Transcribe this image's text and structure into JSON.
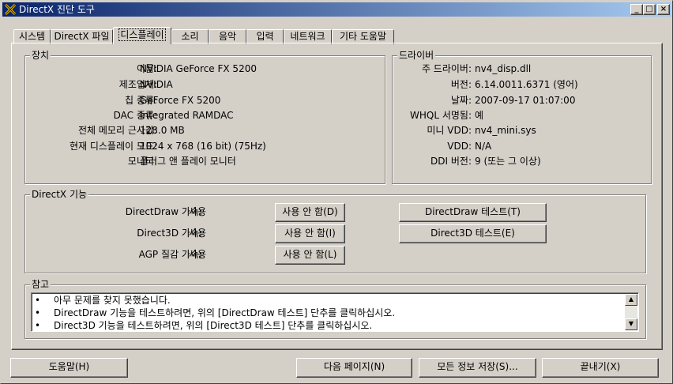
{
  "window": {
    "title": "DirectX 진단 도구",
    "minimize": "_",
    "maximize": "□",
    "close": "×"
  },
  "tabs": [
    {
      "label": "시스템"
    },
    {
      "label": "DirectX 파일"
    },
    {
      "label": "디스플레이"
    },
    {
      "label": "소리"
    },
    {
      "label": "음악"
    },
    {
      "label": "입력"
    },
    {
      "label": "네트워크"
    },
    {
      "label": "기타 도움말"
    }
  ],
  "device": {
    "title": "장치",
    "rows": [
      {
        "label": "이름:",
        "value": "NVIDIA GeForce FX 5200"
      },
      {
        "label": "제조업체:",
        "value": "NVIDIA"
      },
      {
        "label": "칩 종류:",
        "value": "GeForce FX 5200"
      },
      {
        "label": "DAC 종류:",
        "value": "Integrated RAMDAC"
      },
      {
        "label": "전체 메모리 근사값:",
        "value": "128.0 MB"
      },
      {
        "label": "현재 디스플레이 모드:",
        "value": "1024 x 768 (16 bit) (75Hz)"
      },
      {
        "label": "모니터:",
        "value": "플러그 앤 플레이 모니터"
      }
    ]
  },
  "driver": {
    "title": "드라이버",
    "rows": [
      {
        "label": "주 드라이버:",
        "value": "nv4_disp.dll"
      },
      {
        "label": "버전:",
        "value": "6.14.0011.6371 (영어)"
      },
      {
        "label": "날짜:",
        "value": "2007-09-17 01:07:00"
      },
      {
        "label": "WHQL 서명됨:",
        "value": "예"
      },
      {
        "label": "미니 VDD:",
        "value": "nv4_mini.sys"
      },
      {
        "label": "VDD:",
        "value": "N/A"
      },
      {
        "label": "DDI 버전:",
        "value": "9 (또는 그 이상)"
      }
    ]
  },
  "features": {
    "title": "DirectX 기능",
    "rows": [
      {
        "label": "DirectDraw 가속:",
        "value": "사용",
        "button": "사용 안 함(D)"
      },
      {
        "label": "Direct3D 가속:",
        "value": "사용",
        "button": "사용 안 함(I)"
      },
      {
        "label": "AGP 질감 가속:",
        "value": "사용",
        "button": "사용 안 함(L)"
      }
    ],
    "test_directdraw": "DirectDraw 테스트(T)",
    "test_direct3d": "Direct3D 테스트(E)"
  },
  "notes": {
    "title": "참고",
    "bullet": "•",
    "lines": [
      "아무 문제를 찾지 못했습니다.",
      "DirectDraw 기능을 테스트하려면, 위의 [DirectDraw 테스트] 단추를 클릭하십시오.",
      "Direct3D 기능을 테스트하려면, 위의 [Direct3D 테스트] 단추를 클릭하십시오."
    ],
    "scroll_up": "▲",
    "scroll_down": "▼"
  },
  "footer": {
    "help": "도움말(H)",
    "next_page": "다음 페이지(N)",
    "save_all": "모든 정보 저장(S)...",
    "exit": "끝내기(X)"
  }
}
